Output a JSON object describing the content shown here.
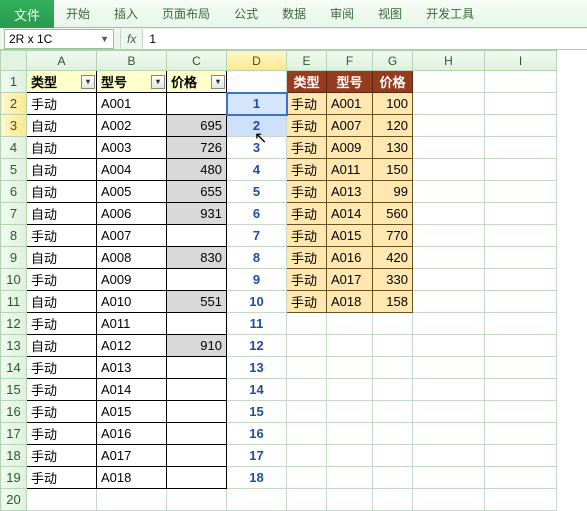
{
  "ribbon": {
    "file": "文件",
    "tabs": [
      "开始",
      "插入",
      "页面布局",
      "公式",
      "数据",
      "审阅",
      "视图",
      "开发工具"
    ]
  },
  "namebox": "2R x 1C",
  "fx_label": "fx",
  "formula": "1",
  "col_headers": [
    "A",
    "B",
    "C",
    "D",
    "E",
    "F",
    "G",
    "H",
    "I"
  ],
  "selected_col_index": 3,
  "row_count": 20,
  "selected_rows": [
    2,
    3
  ],
  "headers": {
    "A": "类型",
    "B": "型号",
    "C": "价格"
  },
  "tableA": [
    {
      "type": "手动",
      "model": "A001",
      "price": ""
    },
    {
      "type": "自动",
      "model": "A002",
      "price": "695"
    },
    {
      "type": "自动",
      "model": "A003",
      "price": "726"
    },
    {
      "type": "自动",
      "model": "A004",
      "price": "480"
    },
    {
      "type": "自动",
      "model": "A005",
      "price": "655"
    },
    {
      "type": "自动",
      "model": "A006",
      "price": "931"
    },
    {
      "type": "手动",
      "model": "A007",
      "price": ""
    },
    {
      "type": "自动",
      "model": "A008",
      "price": "830"
    },
    {
      "type": "手动",
      "model": "A009",
      "price": ""
    },
    {
      "type": "自动",
      "model": "A010",
      "price": "551"
    },
    {
      "type": "手动",
      "model": "A011",
      "price": ""
    },
    {
      "type": "自动",
      "model": "A012",
      "price": "910"
    },
    {
      "type": "手动",
      "model": "A013",
      "price": ""
    },
    {
      "type": "手动",
      "model": "A014",
      "price": ""
    },
    {
      "type": "手动",
      "model": "A015",
      "price": ""
    },
    {
      "type": "手动",
      "model": "A016",
      "price": ""
    },
    {
      "type": "手动",
      "model": "A017",
      "price": ""
    },
    {
      "type": "手动",
      "model": "A018",
      "price": ""
    }
  ],
  "seqD": [
    "1",
    "2",
    "3",
    "4",
    "5",
    "6",
    "7",
    "8",
    "9",
    "10",
    "11",
    "12",
    "13",
    "14",
    "15",
    "16",
    "17",
    "18"
  ],
  "headersE": {
    "E": "类型",
    "F": "型号",
    "G": "价格"
  },
  "tableE": [
    {
      "type": "手动",
      "model": "A001",
      "price": "100"
    },
    {
      "type": "手动",
      "model": "A007",
      "price": "120"
    },
    {
      "type": "手动",
      "model": "A009",
      "price": "130"
    },
    {
      "type": "手动",
      "model": "A011",
      "price": "150"
    },
    {
      "type": "手动",
      "model": "A013",
      "price": "99"
    },
    {
      "type": "手动",
      "model": "A014",
      "price": "560"
    },
    {
      "type": "手动",
      "model": "A015",
      "price": "770"
    },
    {
      "type": "手动",
      "model": "A016",
      "price": "420"
    },
    {
      "type": "手动",
      "model": "A017",
      "price": "330"
    },
    {
      "type": "手动",
      "model": "A018",
      "price": "158"
    }
  ],
  "filter_glyph": "▾"
}
